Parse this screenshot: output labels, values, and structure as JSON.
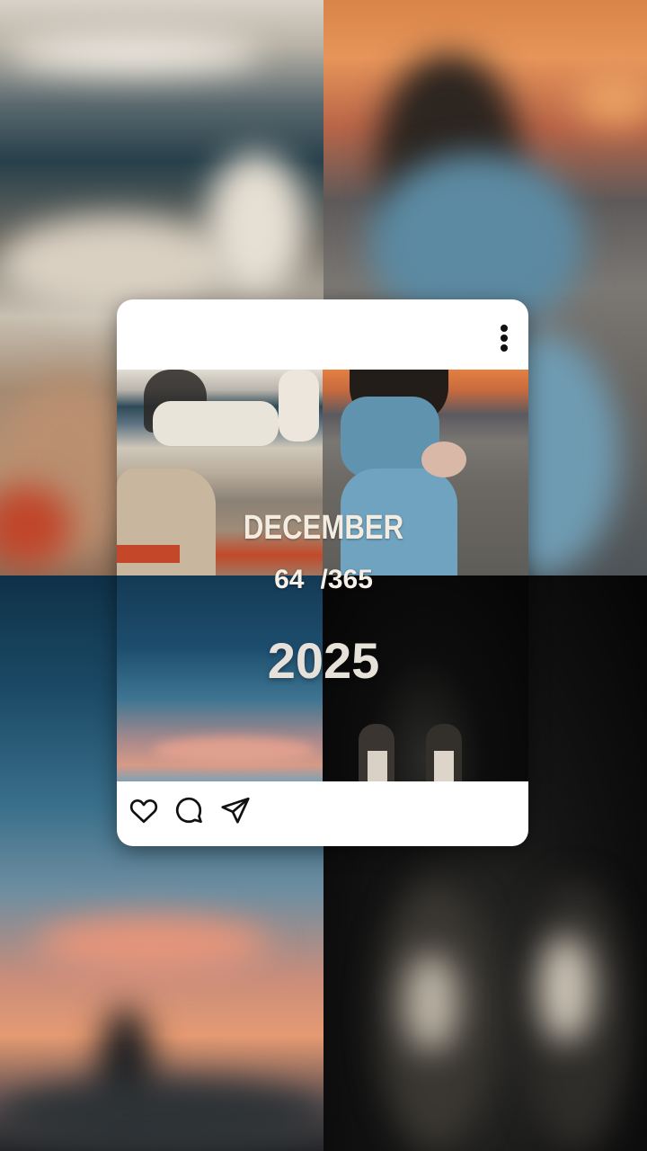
{
  "card": {
    "menu_icon": "more-vertical-icon",
    "actions": [
      {
        "name": "like",
        "icon": "heart-icon"
      },
      {
        "name": "comment",
        "icon": "comment-icon"
      },
      {
        "name": "share",
        "icon": "send-icon"
      }
    ]
  },
  "overlay": {
    "month": "DECEMBER",
    "day_current": "64",
    "day_total": "/365",
    "year": "2025"
  },
  "colors": {
    "card_bg": "#ffffff",
    "text_light": "#f4ece0",
    "year_text": "#e6e2da",
    "icon_stroke": "#111111"
  }
}
